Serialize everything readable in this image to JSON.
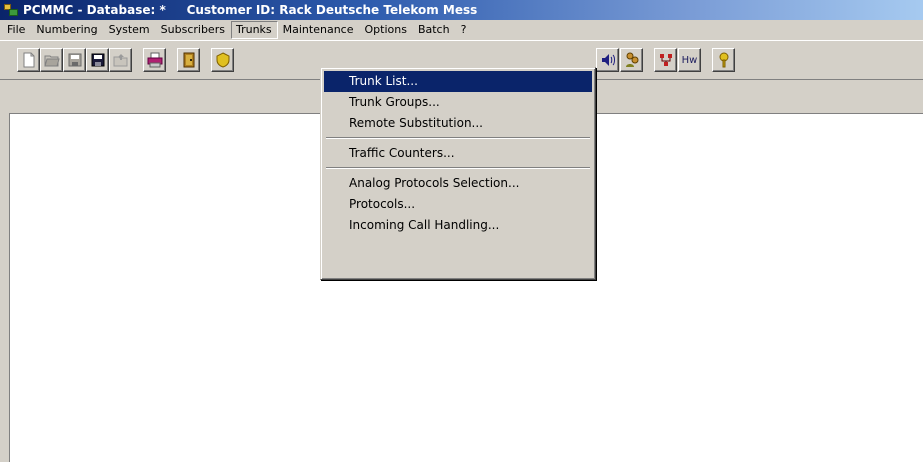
{
  "window": {
    "title": "PCMMC - Database: *     Customer ID: Rack Deutsche Telekom Mess",
    "icon": "app-icon"
  },
  "menubar": {
    "items": [
      {
        "label": "File"
      },
      {
        "label": "Numbering"
      },
      {
        "label": "System"
      },
      {
        "label": "Subscribers"
      },
      {
        "label": "Trunks"
      },
      {
        "label": "Maintenance"
      },
      {
        "label": "Options"
      },
      {
        "label": "Batch"
      },
      {
        "label": "?"
      }
    ],
    "open_menu": "Trunks"
  },
  "toolbar": {
    "buttons": [
      {
        "icon": "new-file-icon"
      },
      {
        "icon": "open-folder-icon"
      },
      {
        "icon": "save-icon"
      },
      {
        "icon": "save-all-icon"
      },
      {
        "icon": "open-disabled-icon"
      },
      {
        "icon": "print-icon"
      },
      {
        "icon": "door-icon"
      },
      {
        "icon": "shield-icon"
      },
      {
        "icon": "speaker-icon"
      },
      {
        "icon": "users-icon"
      },
      {
        "icon": "network-icon"
      },
      {
        "icon": "hardware-icon",
        "label": "Hw"
      },
      {
        "icon": "help-key-icon"
      }
    ]
  },
  "dropdown": {
    "items": [
      {
        "label": "Trunk List...",
        "highlighted": true
      },
      {
        "label": "Trunk Groups..."
      },
      {
        "label": "Remote Substitution..."
      },
      {
        "separator": true
      },
      {
        "label": "Traffic Counters..."
      },
      {
        "separator": true
      },
      {
        "label": "Analog Protocols Selection..."
      },
      {
        "label": "Protocols..."
      },
      {
        "label": "Incoming Call Handling..."
      }
    ]
  },
  "colors": {
    "title_active": "#0a246a",
    "menu_highlight": "#0a246a",
    "face": "#d4d0c8",
    "workspace": "#ffffff"
  }
}
